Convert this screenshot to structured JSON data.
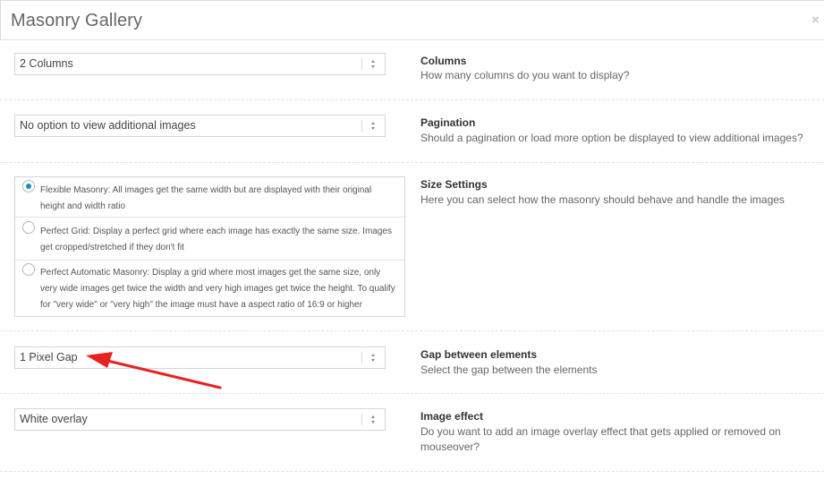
{
  "modal": {
    "title": "Masonry Gallery",
    "close_icon": "×"
  },
  "options": {
    "columns": {
      "value": "2 Columns",
      "title": "Columns",
      "description": "How many columns do you want to display?"
    },
    "pagination": {
      "value": "No option to view additional images",
      "title": "Pagination",
      "description": "Should a pagination or load more option be displayed to view additional images?"
    },
    "size": {
      "title": "Size Settings",
      "description": "Here you can select how the masonry should behave and handle the images",
      "choices": [
        {
          "label": "Flexible Masonry: All images get the same width but are displayed with their original height and width ratio",
          "checked": true
        },
        {
          "label": "Perfect Grid: Display a perfect grid where each image has exactly the same size. Images get cropped/stretched if they don't fit",
          "checked": false
        },
        {
          "label": "Perfect Automatic Masonry: Display a grid where most images get the same size, only very wide images get twice the width and very high images get twice the height. To qualify for \"very wide\" or \"very high\" the image must have a aspect ratio of 16:9 or higher",
          "checked": false
        }
      ]
    },
    "gap": {
      "value": "1 Pixel Gap",
      "title": "Gap between elements",
      "description": "Select the gap between the elements"
    },
    "effect": {
      "value": "White overlay",
      "title": "Image effect",
      "description": "Do you want to add an image overlay effect that gets applied or removed on mouseover?"
    }
  },
  "annotation": {
    "arrow_color": "#e8231d"
  },
  "colors": {
    "radio_checked": "#1e8cbe"
  }
}
